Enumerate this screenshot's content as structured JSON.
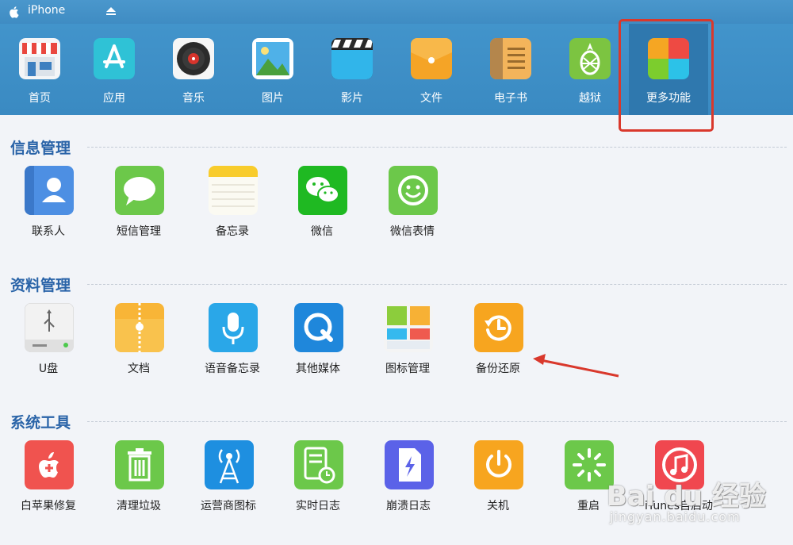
{
  "titlebar": {
    "device_name": "iPhone"
  },
  "toolbar": {
    "items": [
      {
        "label": "首页",
        "icon": "shop-icon"
      },
      {
        "label": "应用",
        "icon": "app-store-icon"
      },
      {
        "label": "音乐",
        "icon": "vinyl-record-icon"
      },
      {
        "label": "图片",
        "icon": "picture-icon"
      },
      {
        "label": "影片",
        "icon": "clapperboard-icon"
      },
      {
        "label": "文件",
        "icon": "folder-icon"
      },
      {
        "label": "电子书",
        "icon": "book-icon"
      },
      {
        "label": "越狱",
        "icon": "pineapple-icon"
      },
      {
        "label": "更多功能",
        "icon": "tiles-icon"
      }
    ],
    "active_index": 8
  },
  "sections": [
    {
      "title": "信息管理",
      "items": [
        {
          "label": "联系人",
          "icon": "contacts-icon"
        },
        {
          "label": "短信管理",
          "icon": "messages-icon"
        },
        {
          "label": "备忘录",
          "icon": "notes-icon"
        },
        {
          "label": "微信",
          "icon": "wechat-icon"
        },
        {
          "label": "微信表情",
          "icon": "smiley-icon"
        }
      ]
    },
    {
      "title": "资料管理",
      "items": [
        {
          "label": "U盘",
          "icon": "usb-drive-icon"
        },
        {
          "label": "文档",
          "icon": "document-folder-icon"
        },
        {
          "label": "语音备忘录",
          "icon": "microphone-icon"
        },
        {
          "label": "其他媒体",
          "icon": "quicktime-icon"
        },
        {
          "label": "图标管理",
          "icon": "icon-tiles-icon"
        },
        {
          "label": "备份还原",
          "icon": "backup-restore-icon"
        }
      ]
    },
    {
      "title": "系统工具",
      "items": [
        {
          "label": "白苹果修复",
          "icon": "apple-repair-icon"
        },
        {
          "label": "清理垃圾",
          "icon": "trash-icon"
        },
        {
          "label": "运营商图标",
          "icon": "signal-tower-icon"
        },
        {
          "label": "实时日志",
          "icon": "log-clock-icon"
        },
        {
          "label": "崩溃日志",
          "icon": "crash-log-icon"
        },
        {
          "label": "关机",
          "icon": "power-icon"
        },
        {
          "label": "重启",
          "icon": "restart-icon"
        },
        {
          "label": "iTunes自启动",
          "icon": "itunes-icon"
        }
      ]
    }
  ],
  "watermark": {
    "brand": "Bai du 经验",
    "site": "jingyan.baidu.com"
  },
  "colors": {
    "toolbar": "#3a8ac2",
    "section_title": "#2a64a8",
    "highlight": "#d9382c"
  }
}
